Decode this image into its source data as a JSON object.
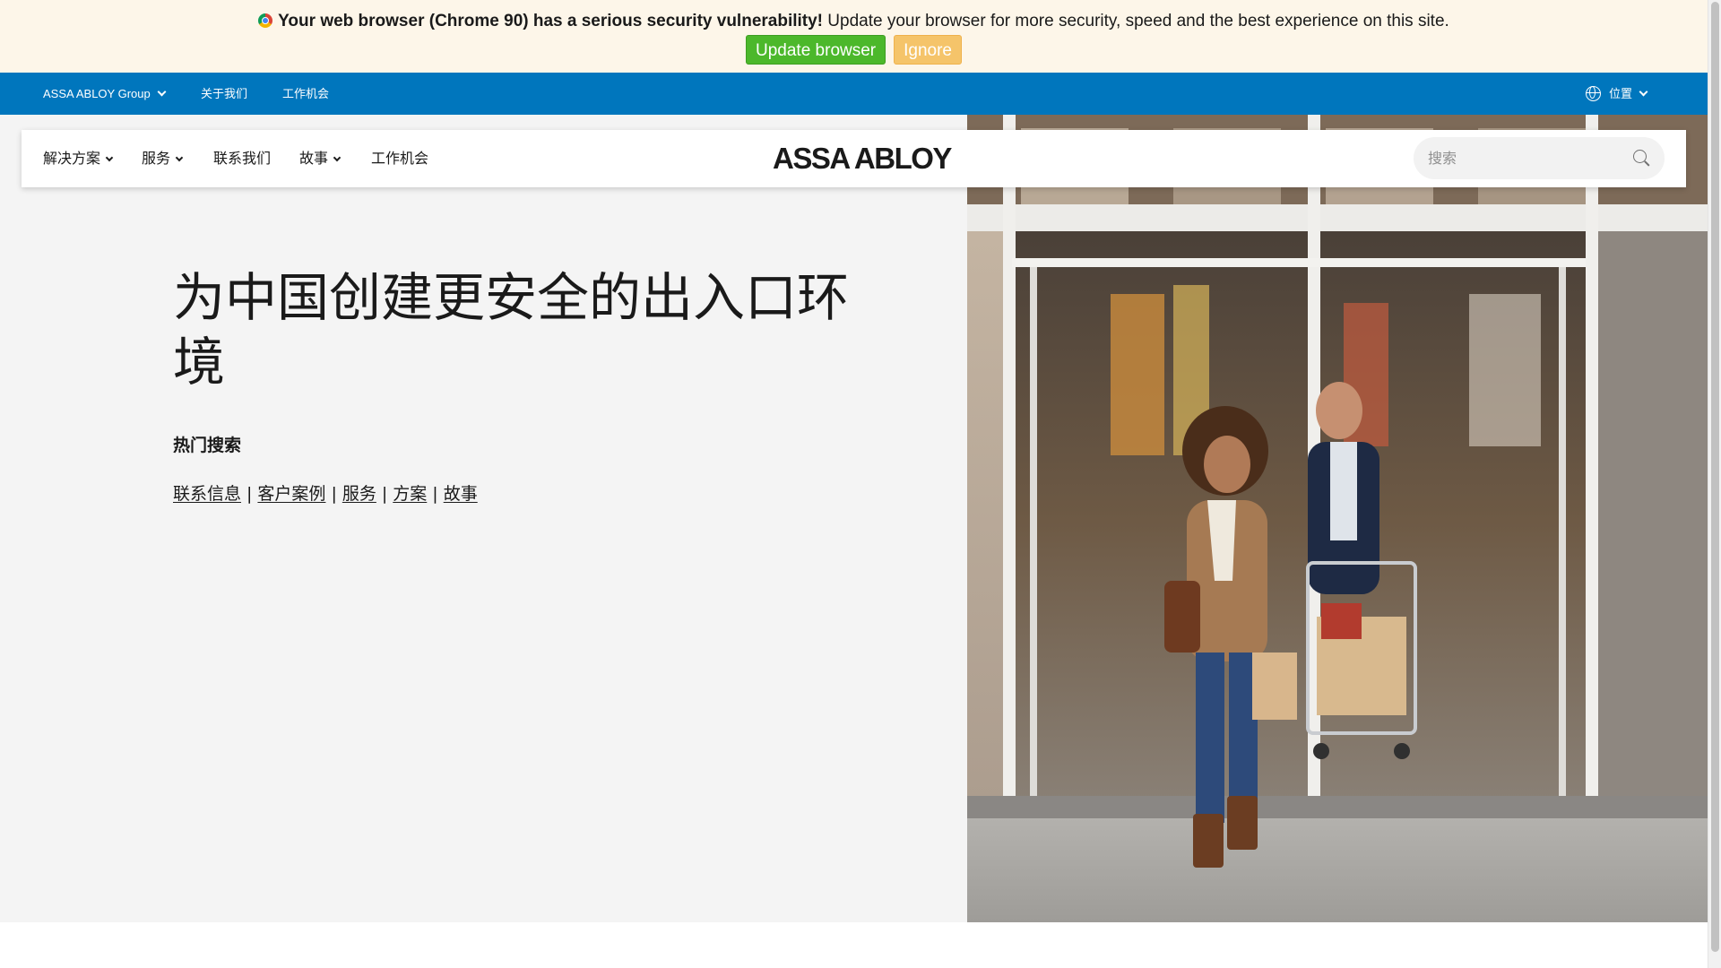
{
  "banner": {
    "strong_text": "Your web browser (Chrome 90) has a serious security vulnerability!",
    "message": "Update your browser for more security, speed and the best experience on this site.",
    "update_label": "Update browser",
    "ignore_label": "Ignore",
    "icon": "chrome-icon"
  },
  "utility_bar": {
    "group_label": "ASSA ABLOY Group",
    "about_label": "关于我们",
    "careers_label": "工作机会",
    "location_label": "位置",
    "background": "#0076bd"
  },
  "main_nav": {
    "items": [
      {
        "label": "解决方案",
        "has_dropdown": true
      },
      {
        "label": "服务",
        "has_dropdown": true
      },
      {
        "label": "联系我们",
        "has_dropdown": false
      },
      {
        "label": "故事",
        "has_dropdown": true
      },
      {
        "label": "工作机会",
        "has_dropdown": false
      }
    ],
    "logo_text": "ASSA ABLOY",
    "search_placeholder": "搜索",
    "search_value": ""
  },
  "hero": {
    "title": "为中国创建更安全的出入口环境",
    "hot_search_heading": "热门搜索",
    "hot_links": [
      "联系信息",
      "客户案例",
      "服务",
      "方案",
      "故事"
    ],
    "separator": "|"
  },
  "colors": {
    "banner_bg": "#fdf6e9",
    "update_button": "#4cb82b",
    "ignore_button": "#f5c46a",
    "utility_bar": "#0076bd",
    "hero_bg": "#f4f4f4"
  }
}
